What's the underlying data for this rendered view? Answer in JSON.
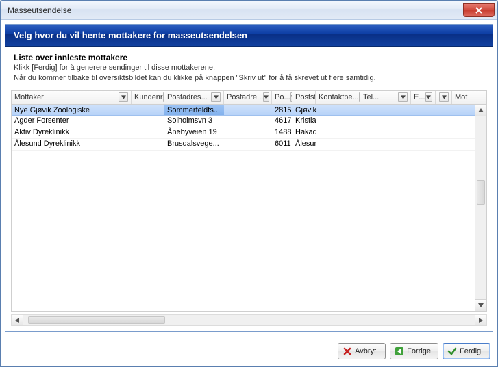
{
  "window_title": "Masseutsendelse",
  "subheader": "Velg hvor du vil hente mottakere for masseutsendelsen",
  "info": {
    "title": "Liste over innleste mottakere",
    "line1": "Klikk [Ferdig] for å generere sendinger til disse mottakerene.",
    "line2": "Når du kommer tilbake til oversiktsbildet kan du klikke på knappen \"Skriv ut\" for å få skrevet ut flere samtidig."
  },
  "columns": [
    "Mottaker",
    "Kundenr",
    "Postadres...",
    "Postadre...",
    "Po...",
    "Postst...",
    "Kontaktpe...",
    "Tel...",
    "E...",
    "Mot"
  ],
  "rows": [
    {
      "mottaker": "Nye Gjøvik Zoologiske",
      "kundenr": "",
      "postadr1": "Sommerfeldts...",
      "postadr2": "",
      "postnr": "2815",
      "poststed": "Gjøvik",
      "kontakt": "",
      "tel": "",
      "e": "",
      "selected": true
    },
    {
      "mottaker": "Agder Forsenter",
      "kundenr": "",
      "postadr1": "Solholmsvn 3",
      "postadr2": "",
      "postnr": "4617",
      "poststed": "Kristiansa...",
      "kontakt": "",
      "tel": "",
      "e": ""
    },
    {
      "mottaker": "Aktiv Dyreklinikk",
      "kundenr": "",
      "postadr1": "Ånebyveien 19",
      "postadr2": "",
      "postnr": "1488",
      "poststed": "Hakadal",
      "kontakt": "",
      "tel": "",
      "e": ""
    },
    {
      "mottaker": "Ålesund Dyreklinikk",
      "kundenr": "",
      "postadr1": "Brusdalsvege...",
      "postadr2": "",
      "postnr": "6011",
      "poststed": "Ålesund",
      "kontakt": "",
      "tel": "",
      "e": ""
    }
  ],
  "buttons": {
    "cancel": "Avbryt",
    "prev": "Forrige",
    "finish": "Ferdig"
  }
}
